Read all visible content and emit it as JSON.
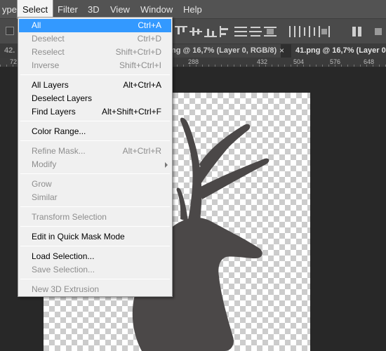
{
  "menubar": {
    "items": [
      {
        "label": "ype"
      },
      {
        "label": "Select"
      },
      {
        "label": "Filter"
      },
      {
        "label": "3D"
      },
      {
        "label": "View"
      },
      {
        "label": "Window"
      },
      {
        "label": "Help"
      }
    ]
  },
  "tabs": {
    "left": "42.",
    "middle": "ng @ 16,7% (Layer 0, RGB/8)",
    "close": "×",
    "right": "41.png @ 16,7% (Layer 0"
  },
  "ruler": {
    "labels": [
      "72",
      "288",
      "432",
      "504",
      "576",
      "648"
    ]
  },
  "select_menu": {
    "items": [
      {
        "label": "All",
        "shortcut": "Ctrl+A",
        "enabled": true,
        "highlighted": true
      },
      {
        "label": "Deselect",
        "shortcut": "Ctrl+D",
        "enabled": false
      },
      {
        "label": "Reselect",
        "shortcut": "Shift+Ctrl+D",
        "enabled": false
      },
      {
        "label": "Inverse",
        "shortcut": "Shift+Ctrl+I",
        "enabled": false
      },
      {
        "label": "All Layers",
        "shortcut": "Alt+Ctrl+A",
        "enabled": true
      },
      {
        "label": "Deselect Layers",
        "shortcut": "",
        "enabled": true
      },
      {
        "label": "Find Layers",
        "shortcut": "Alt+Shift+Ctrl+F",
        "enabled": true
      },
      {
        "label": "Color Range...",
        "shortcut": "",
        "enabled": true
      },
      {
        "label": "Refine Mask...",
        "shortcut": "Alt+Ctrl+R",
        "enabled": false
      },
      {
        "label": "Modify",
        "shortcut": "",
        "enabled": false,
        "submenu": true
      },
      {
        "label": "Grow",
        "shortcut": "",
        "enabled": false
      },
      {
        "label": "Similar",
        "shortcut": "",
        "enabled": false
      },
      {
        "label": "Transform Selection",
        "shortcut": "",
        "enabled": false
      },
      {
        "label": "Edit in Quick Mask Mode",
        "shortcut": "",
        "enabled": true
      },
      {
        "label": "Load Selection...",
        "shortcut": "",
        "enabled": true
      },
      {
        "label": "Save Selection...",
        "shortcut": "",
        "enabled": false
      },
      {
        "label": "New 3D Extrusion",
        "shortcut": "",
        "enabled": false
      }
    ]
  },
  "colors": {
    "highlight": "#3399ff",
    "menubar_bg": "#535353",
    "menu_bg": "#f0f0f0",
    "disabled_text": "#8d8d8d"
  }
}
